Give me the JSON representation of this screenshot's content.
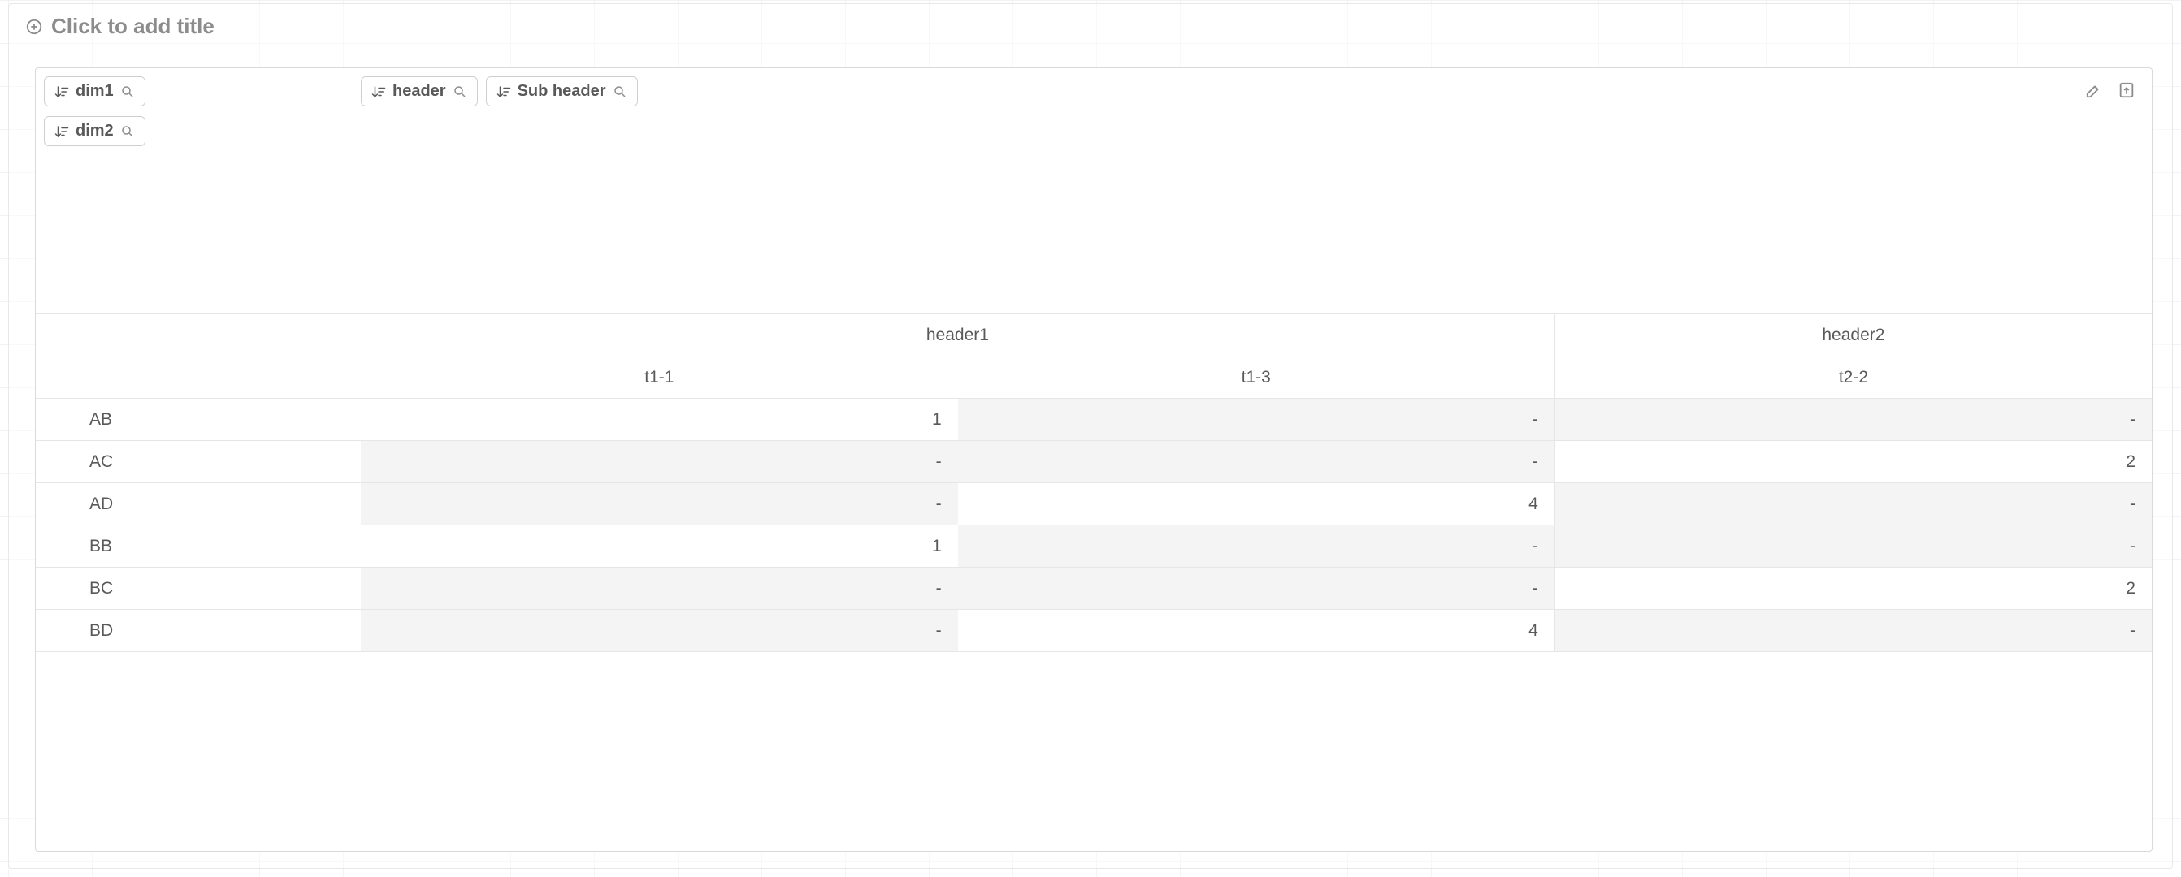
{
  "title_placeholder": "Click to add title",
  "dimensions": {
    "row_chips": [
      "dim1",
      "dim2"
    ],
    "col_chips": [
      "header",
      "Sub header"
    ]
  },
  "pivot": {
    "top_headers": [
      {
        "label": "header1",
        "span": 2
      },
      {
        "label": "header2",
        "span": 1
      }
    ],
    "sub_headers": [
      "t1-1",
      "t1-3",
      "t2-2"
    ],
    "rows": [
      {
        "key": "AB",
        "cells": [
          {
            "v": "1",
            "null": false
          },
          {
            "v": "-",
            "null": true
          },
          {
            "v": "-",
            "null": true
          }
        ]
      },
      {
        "key": "AC",
        "cells": [
          {
            "v": "-",
            "null": true
          },
          {
            "v": "-",
            "null": true
          },
          {
            "v": "2",
            "null": false
          }
        ]
      },
      {
        "key": "AD",
        "cells": [
          {
            "v": "-",
            "null": true
          },
          {
            "v": "4",
            "null": false
          },
          {
            "v": "-",
            "null": true
          }
        ]
      },
      {
        "key": "BB",
        "cells": [
          {
            "v": "1",
            "null": false
          },
          {
            "v": "-",
            "null": true
          },
          {
            "v": "-",
            "null": true
          }
        ]
      },
      {
        "key": "BC",
        "cells": [
          {
            "v": "-",
            "null": true
          },
          {
            "v": "-",
            "null": true
          },
          {
            "v": "2",
            "null": false
          }
        ]
      },
      {
        "key": "BD",
        "cells": [
          {
            "v": "-",
            "null": true
          },
          {
            "v": "4",
            "null": false
          },
          {
            "v": "-",
            "null": true
          }
        ]
      }
    ]
  }
}
